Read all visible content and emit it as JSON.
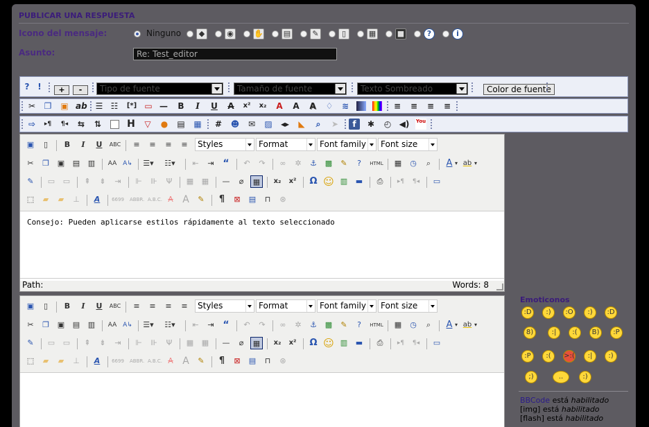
{
  "form": {
    "title": "PUBLICAR UNA RESPUESTA",
    "icon_label": "Icono del mensaje:",
    "icon_none_label": "Ninguno",
    "icon_options": [
      "ghost-icon",
      "camera-icon",
      "hand-icon",
      "film-icon",
      "sticker-icon",
      "document-icon",
      "image-icon",
      "dark-photo-icon",
      "question-icon",
      "info-icon"
    ],
    "subject_label": "Asunto:",
    "subject_value": "Re: Test_editor"
  },
  "bbtoolbar": {
    "plus_label": "+",
    "minus_label": "-",
    "font_type": "Tipo de fuente",
    "font_size": "Tamaño de fuente",
    "text_shadow": "Texto Sombreado",
    "color_button": "Color de fuente",
    "row2": [
      "scissors-icon",
      "copy-icon",
      "paste-icon",
      "ab-icon",
      "bullet-list-icon",
      "numbered-list-icon",
      "list-item-icon",
      "code-icon",
      "horizontal-rule-icon",
      "bold-icon",
      "italic-icon",
      "underline-icon",
      "strikethrough-icon",
      "superscript-icon",
      "subscript-icon",
      "text-red-icon",
      "text-glow-icon",
      "text-shadow-icon",
      "drop-icon",
      "wave-icon",
      "gradient-icon",
      "rainbow-icon",
      "align-left-icon",
      "align-center-icon",
      "align-right-icon",
      "justify-icon"
    ],
    "row3": [
      "hide-icon",
      "ltr-icon",
      "rtl-icon",
      "marquee-icon",
      "marquee-vertical-icon",
      "box-icon",
      "heading-icon",
      "warning-icon",
      "lips-icon",
      "spoiler-icon",
      "table-icon",
      "hash-icon",
      "user-icon",
      "email-icon",
      "image-icon",
      "flash-icon",
      "stream-icon",
      "search-icon",
      "pointer-icon",
      "facebook-icon",
      "bug-icon",
      "clock-icon",
      "sound-icon",
      "youtube-icon"
    ]
  },
  "editor1": {
    "styles": "Styles",
    "format": "Format",
    "font_family": "Font family",
    "font_size": "Font size",
    "content": "Consejo: Pueden aplicarse estilos rápidamente al texto seleccionado",
    "path_label": "Path:",
    "words": "Words: 8"
  },
  "editor2": {
    "styles": "Styles",
    "format": "Format",
    "font_family": "Font family",
    "font_size": "Font size"
  },
  "emoticons": {
    "title": "Emoticonos",
    "faces": [
      ":D",
      ":)",
      ":O",
      ":)",
      ":D",
      "8)",
      ":|",
      ":(",
      "B)",
      ":P",
      ":P",
      ":(",
      ">:(",
      ":|",
      ":)",
      ";)",
      "..",
      ":)"
    ]
  },
  "bbinfo": [
    {
      "name": "BBCode",
      "text": "está",
      "state": "habilitado"
    },
    {
      "name": "[img]",
      "text": "está",
      "state": "habilitado"
    },
    {
      "name": "[flash]",
      "text": "está",
      "state": "habilitado"
    }
  ],
  "glyphs": {
    "bold": "B",
    "italic": "I",
    "underline": "U",
    "abc": "ABC",
    "sub": "x₂",
    "sup": "x²",
    "omega": "Ω",
    "smile": "☺",
    "para": "¶",
    "quote": "“",
    "anchor": "⚓",
    "help": "?",
    "html": "HTML",
    "ab": "ab",
    "bracket": "[*]",
    "heading": "H",
    "hash": "#",
    "warn": "▽",
    "fb": "f",
    "yt": "You",
    "font_a": "A",
    "search": "⌕",
    "underline_a": "A",
    "ab_hl": "ab"
  }
}
